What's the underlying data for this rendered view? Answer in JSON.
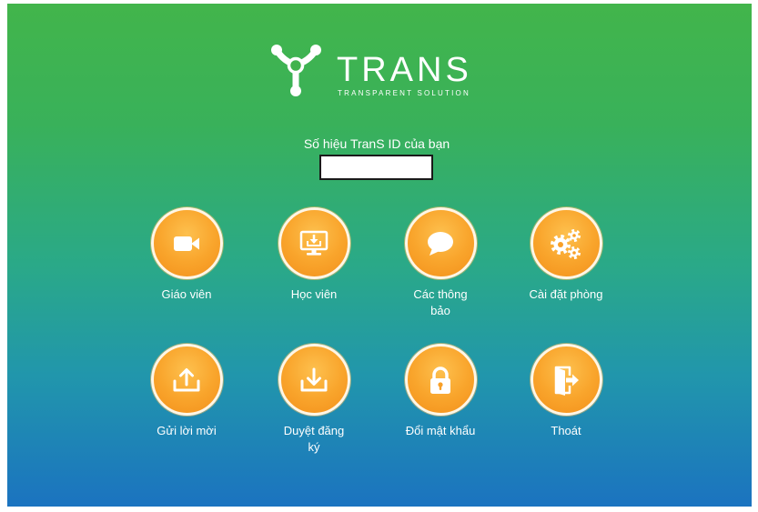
{
  "brand": {
    "name": "TRANS",
    "tagline": "TRANSPARENT SOLUTION",
    "logo_icon": "trans-logo-icon"
  },
  "id_section": {
    "label": "Số hiệu TranS ID của bạn",
    "value": ""
  },
  "menu": [
    {
      "label": "Giáo viên",
      "icon": "video-camera-icon"
    },
    {
      "label": "Học viên",
      "icon": "monitor-download-icon"
    },
    {
      "label": "Các thông\nbảo",
      "icon": "speech-bubble-icon"
    },
    {
      "label": "Cài đặt phòng",
      "icon": "gears-icon"
    },
    {
      "label": "Gửi lời mời",
      "icon": "upload-icon"
    },
    {
      "label": "Duyệt đăng\nký",
      "icon": "download-icon"
    },
    {
      "label": "Đổi mật khẩu",
      "icon": "lock-icon"
    },
    {
      "label": "Thoát",
      "icon": "door-exit-icon"
    }
  ],
  "colors": {
    "background_top": "#42b54b",
    "background_bottom": "#1b73c0",
    "button_orange": "#f3901b",
    "text": "#ffffff"
  }
}
